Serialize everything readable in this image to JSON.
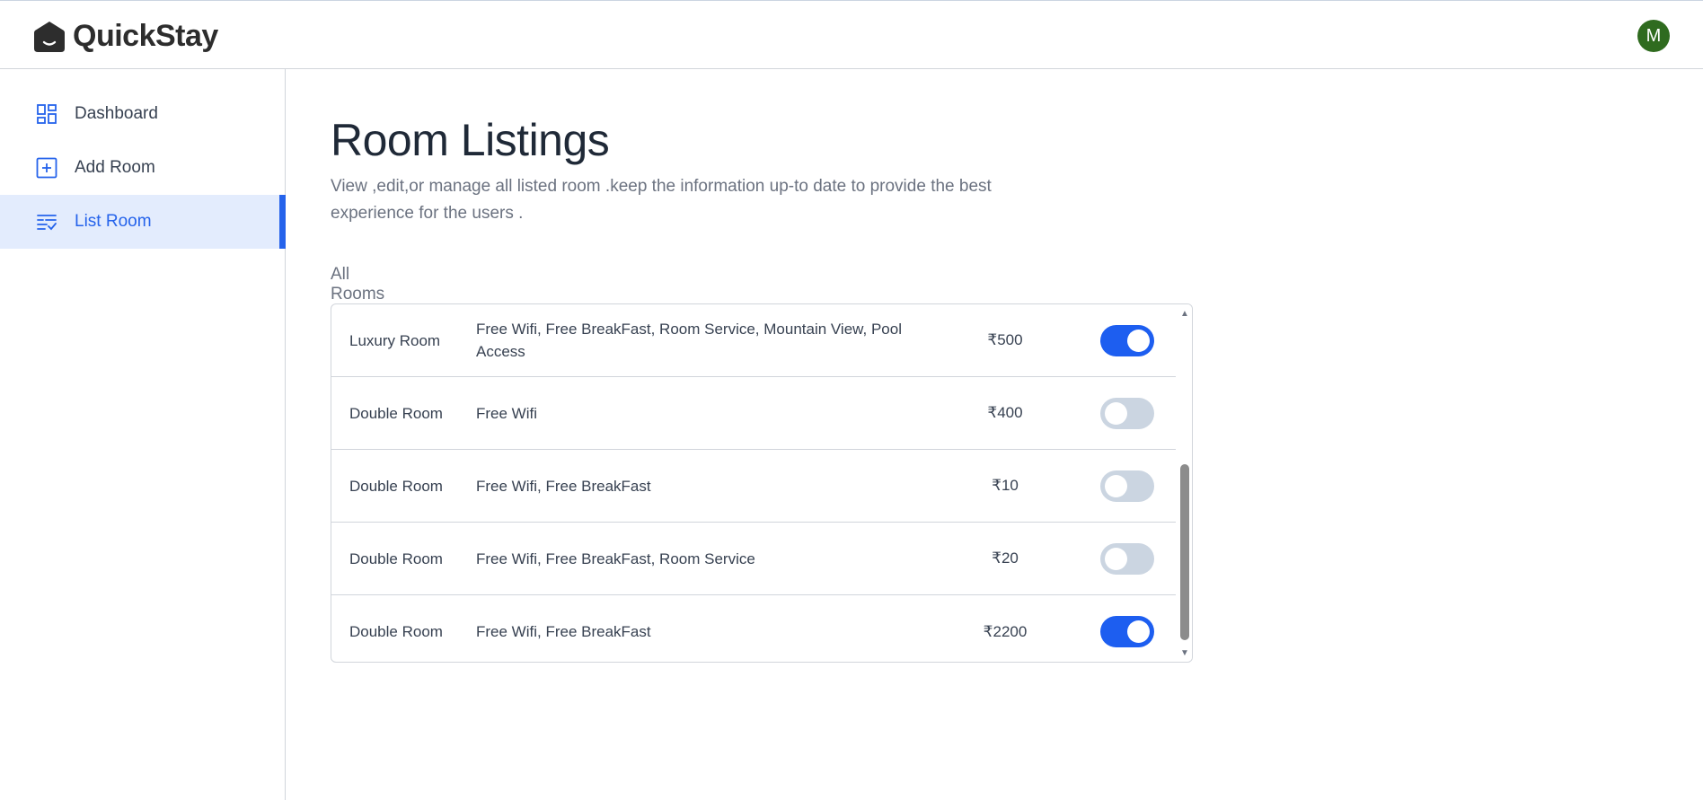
{
  "header": {
    "app_name": "QuickStay",
    "avatar_initial": "M",
    "avatar_color": "#2f6b1f"
  },
  "sidebar": {
    "items": [
      {
        "label": "Dashboard",
        "icon": "dashboard-icon",
        "active": false
      },
      {
        "label": "Add Room",
        "icon": "add-square-icon",
        "active": false
      },
      {
        "label": "List Room",
        "icon": "list-check-icon",
        "active": true
      }
    ]
  },
  "main": {
    "title": "Room Listings",
    "description": "View ,edit,or manage all listed room .keep the information up-to date to provide the best experience for the users .",
    "section_label": "All Rooms"
  },
  "rooms": [
    {
      "name": "Luxury Room",
      "amenities": "Free Wifi, Free BreakFast, Room Service, Mountain View, Pool Access",
      "price": "₹500",
      "available": true
    },
    {
      "name": "Double Room",
      "amenities": "Free Wifi",
      "price": "₹400",
      "available": false
    },
    {
      "name": "Double Room",
      "amenities": "Free Wifi, Free BreakFast",
      "price": "₹10",
      "available": false
    },
    {
      "name": "Double Room",
      "amenities": "Free Wifi, Free BreakFast, Room Service",
      "price": "₹20",
      "available": false
    },
    {
      "name": "Double Room",
      "amenities": "Free Wifi, Free BreakFast",
      "price": "₹2200",
      "available": true
    }
  ],
  "colors": {
    "accent": "#2563eb",
    "toggle_on": "#1d5ef0",
    "toggle_off": "#cbd5e1",
    "active_bg": "#e3ecfd"
  }
}
